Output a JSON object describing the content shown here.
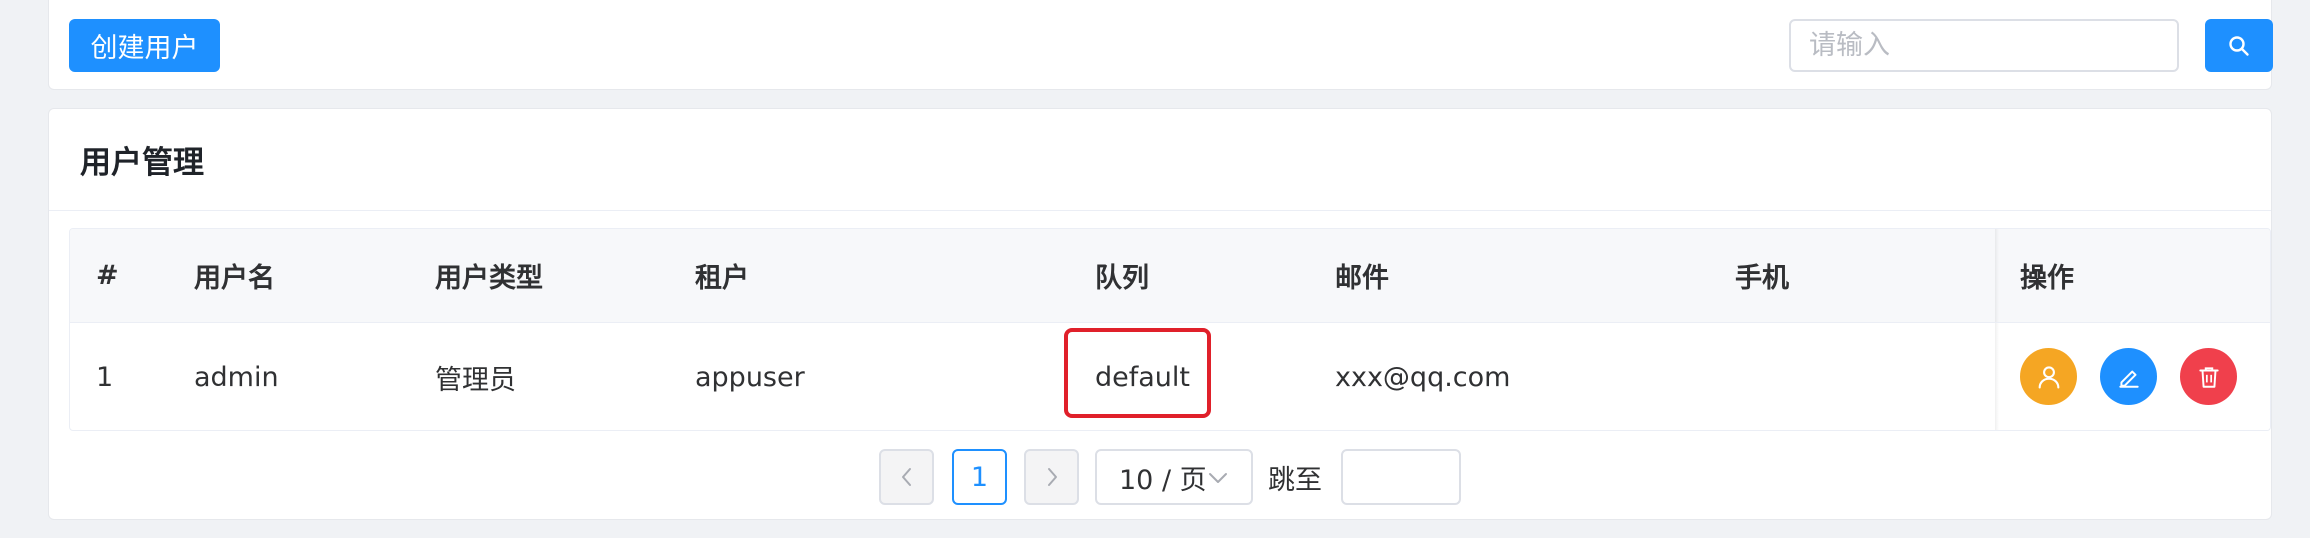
{
  "toolbar": {
    "create_label": "创建用户",
    "search_placeholder": "请输入"
  },
  "card": {
    "title": "用户管理"
  },
  "table": {
    "columns": [
      "#",
      "用户名",
      "用户类型",
      "租户",
      "队列",
      "邮件",
      "手机",
      "操作"
    ],
    "rows": [
      {
        "index": "1",
        "username": "admin",
        "user_type": "管理员",
        "tenant": "appuser",
        "queue": "default",
        "email": "xxx@qq.com",
        "phone": ""
      }
    ],
    "actions": [
      "user-icon",
      "edit-icon",
      "delete-icon"
    ]
  },
  "pagination": {
    "current_page": "1",
    "page_size_label": "10 / 页",
    "jump_label": "跳至"
  },
  "colors": {
    "primary": "#1e90ff",
    "warning": "#f5a623",
    "danger": "#f0404c",
    "highlight": "#e0202a"
  }
}
